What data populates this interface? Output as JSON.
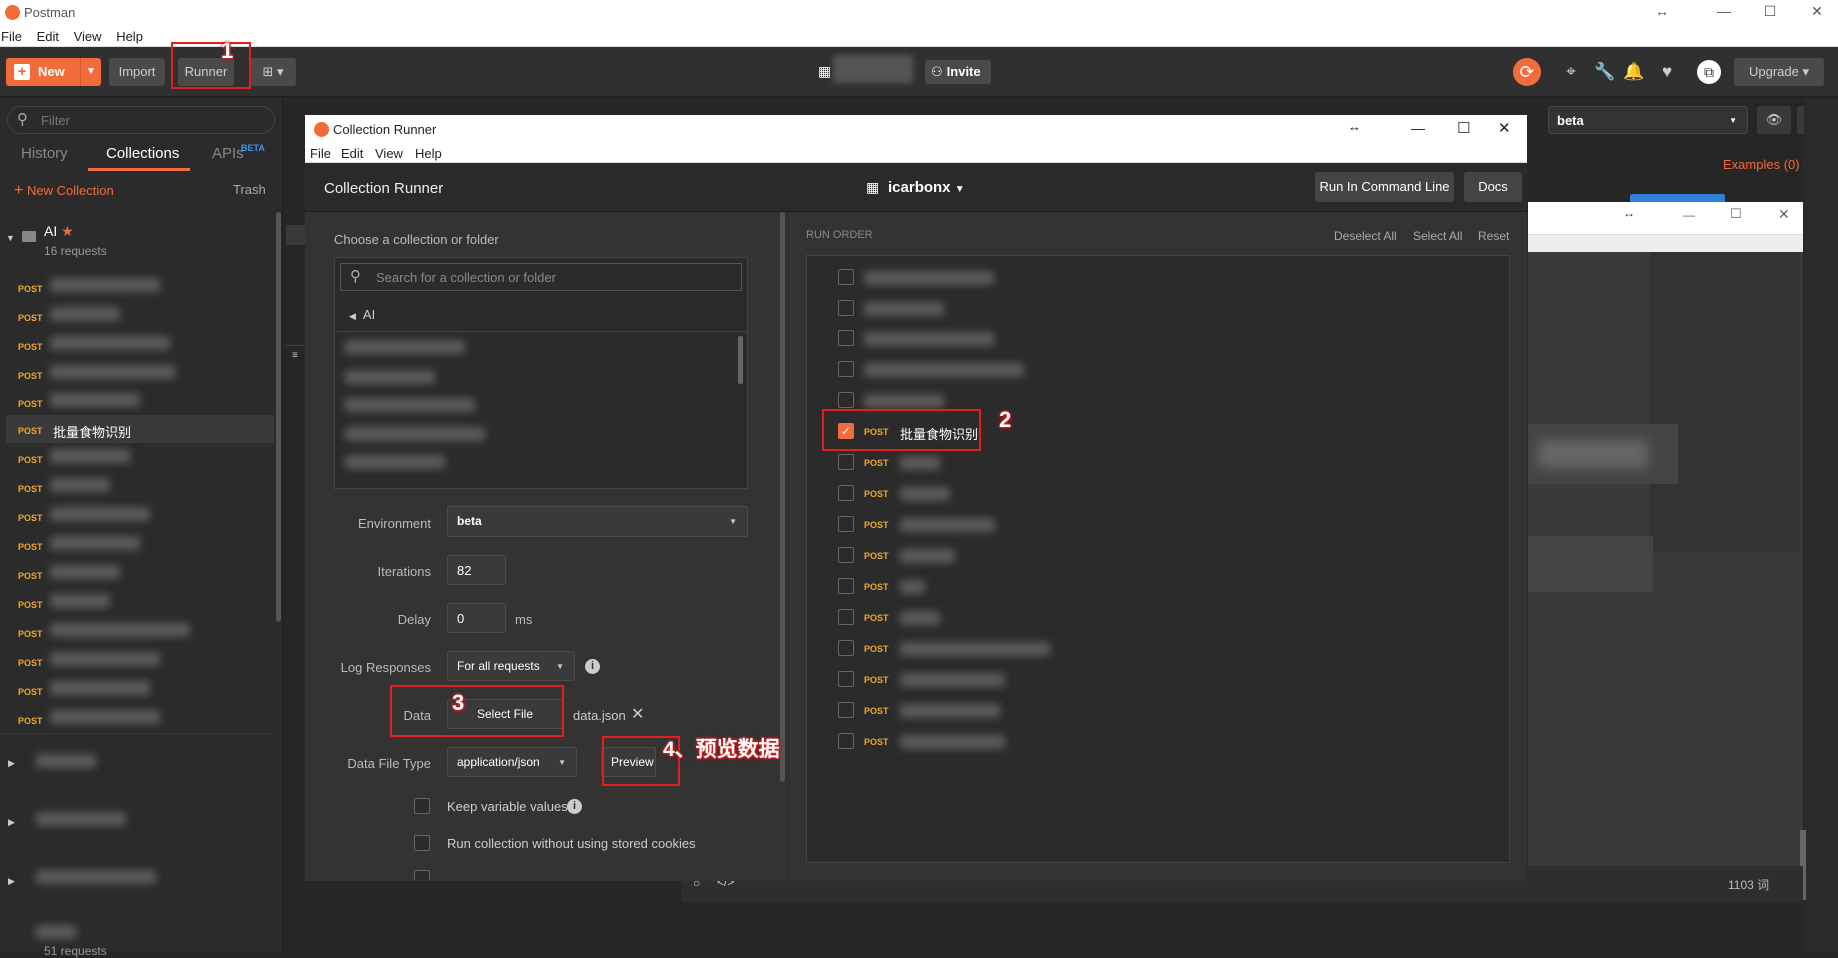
{
  "app": {
    "title": "Postman",
    "menu": [
      "File",
      "Edit",
      "View",
      "Help"
    ]
  },
  "toolbar": {
    "new": "New",
    "import": "Import",
    "runner": "Runner",
    "invite": "Invite",
    "upgrade": "Upgrade"
  },
  "sidebar": {
    "filter_placeholder": "Filter",
    "tabs": [
      "History",
      "Collections",
      "APIs"
    ],
    "apis_badge": "BETA",
    "new_collection": "New Collection",
    "trash": "Trash",
    "collection": {
      "name": "AI",
      "count": "16 requests"
    },
    "method": "POST",
    "selected_request": "批量食物识别",
    "bottom_count": "51 requests"
  },
  "right": {
    "environment": "beta",
    "examples": "Examples (0)",
    "word_count": "1103 词"
  },
  "runner": {
    "window_title": "Collection Runner",
    "menu": [
      "File",
      "Edit",
      "View",
      "Help"
    ],
    "heading": "Collection Runner",
    "workspace": "icarbonx",
    "run_cmd": "Run In Command Line",
    "docs": "Docs",
    "choose_label": "Choose a collection or folder",
    "search_placeholder": "Search for a collection or folder",
    "breadcrumb": "AI",
    "environment_label": "Environment",
    "environment_value": "beta",
    "iterations_label": "Iterations",
    "iterations_value": "82",
    "delay_label": "Delay",
    "delay_value": "0",
    "delay_unit": "ms",
    "log_label": "Log Responses",
    "log_value": "For all requests",
    "data_label": "Data",
    "select_file": "Select File",
    "data_file": "data.json",
    "data_type_label": "Data File Type",
    "data_type_value": "application/json",
    "preview": "Preview",
    "keep_vars": "Keep variable values",
    "no_cookies": "Run collection without using stored cookies",
    "run_order": "RUN ORDER",
    "deselect_all": "Deselect All",
    "select_all": "Select All",
    "reset": "Reset",
    "checked_request": "批量食物识别",
    "method": "POST"
  },
  "annotations": {
    "n1": "1",
    "n2": "2",
    "n3": "3",
    "n4": "4、预览数据"
  },
  "colors": {
    "accent": "#f26b3a",
    "post": "#f5a623",
    "annotation": "#e02020"
  }
}
